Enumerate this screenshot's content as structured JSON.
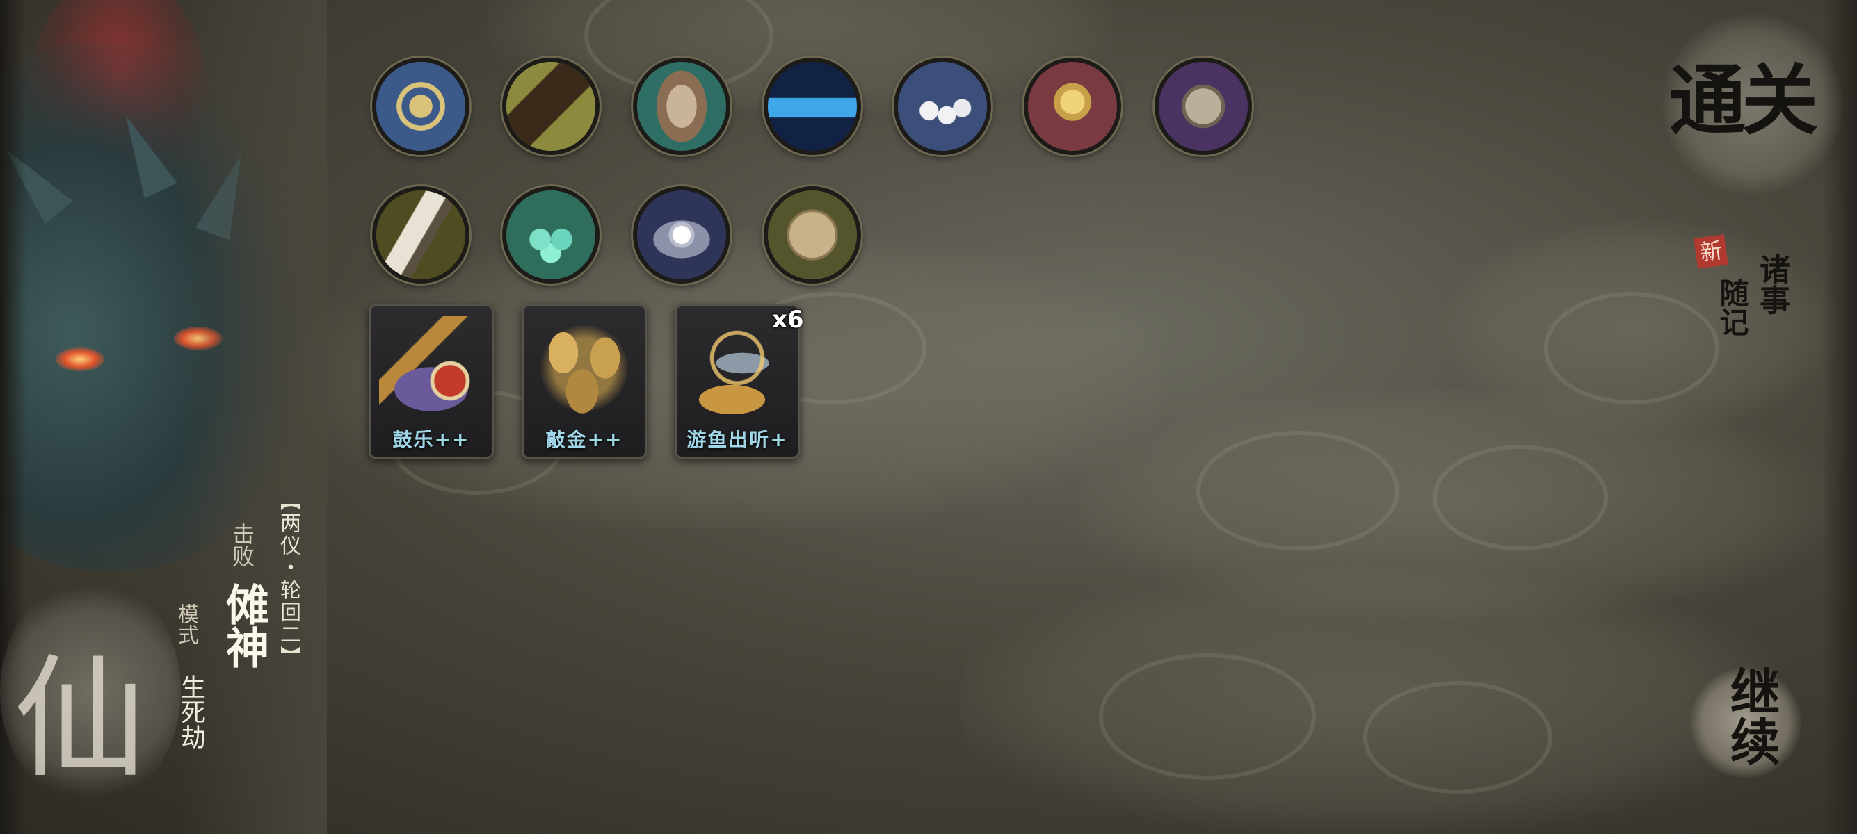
{
  "relics_row1": [
    {
      "icon": "triskelion-relic-icon",
      "bg": "#3b5a8a"
    },
    {
      "icon": "guqin-relic-icon",
      "bg": "#7a7a3a"
    },
    {
      "icon": "amber-stone-relic-icon",
      "bg": "#2f6e64"
    },
    {
      "icon": "blue-bead-necklace-relic-icon",
      "bg": "#1b3a6e"
    },
    {
      "icon": "pearls-relic-icon",
      "bg": "#3c4f7a"
    },
    {
      "icon": "golden-flower-relic-icon",
      "bg": "#7a3a42"
    },
    {
      "icon": "beast-mask-relic-icon",
      "bg": "#4a3360"
    }
  ],
  "relics_row2": [
    {
      "icon": "horn-relic-icon",
      "bg": "#4e4c20"
    },
    {
      "icon": "jade-stones-relic-icon",
      "bg": "#2f6e5c"
    },
    {
      "icon": "pearl-shell-relic-icon",
      "bg": "#2e3558"
    },
    {
      "icon": "bronze-coin-relic-icon",
      "bg": "#54552c"
    }
  ],
  "cards": [
    {
      "label": "鼓乐++",
      "icon": "drum-music-card-icon"
    },
    {
      "label": "敲金++",
      "icon": "bronze-bells-card-icon"
    },
    {
      "label": "游鱼出听+",
      "icon": "leaping-fish-card-icon",
      "stack": "x6"
    }
  ],
  "boss": {
    "bracket": "【两仪・轮回二】",
    "title_small": "击败",
    "name": "傩神",
    "mode_small": "模式",
    "mode": "生死劫",
    "seal_char": "仙"
  },
  "right_menu": {
    "clearance": "通关",
    "new_badge": "新",
    "notes": "随记",
    "events": "诸事",
    "continue": "继续"
  },
  "colors": {
    "card_label": "#9fd6e8",
    "new_badge": "#b03a30"
  }
}
